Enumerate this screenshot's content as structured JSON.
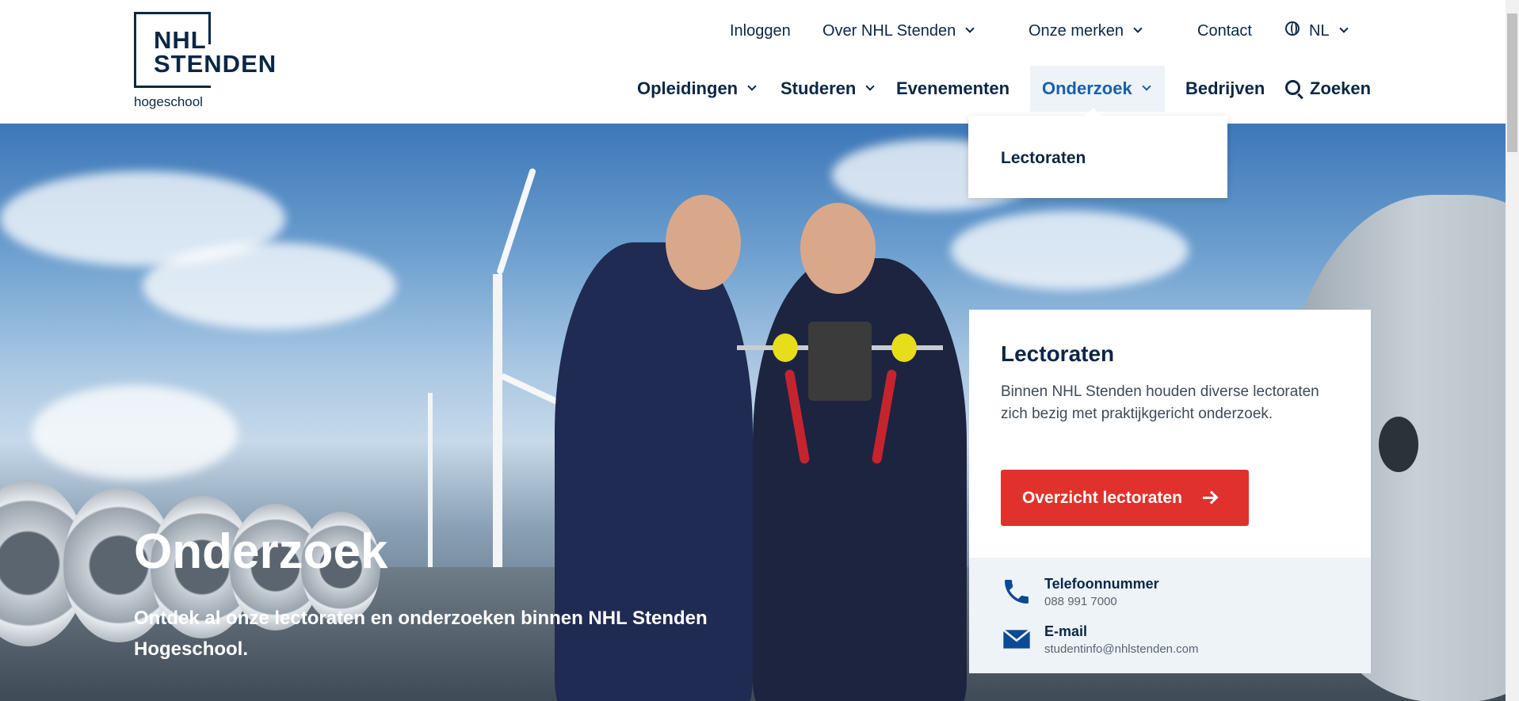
{
  "logo": {
    "line1": "NHL",
    "line2": "STENDEN",
    "sub": "hogeschool"
  },
  "topnav": {
    "login": "Inloggen",
    "about": "Over NHL Stenden",
    "brands": "Onze merken",
    "contact": "Contact",
    "language": "NL"
  },
  "mainnav": {
    "programs": "Opleidingen",
    "study": "Studeren",
    "events": "Evenementen",
    "research": "Onderzoek",
    "business": "Bedrijven",
    "search": "Zoeken"
  },
  "dropdown": {
    "item": "Lectoraten"
  },
  "hero": {
    "title": "Onderzoek",
    "subtitle": "Ontdek al onze lectoraten en onderzoeken binnen NHL Stenden Hogeschool."
  },
  "card": {
    "title": "Lectoraten",
    "text": "Binnen NHL Stenden houden diverse lectoraten zich bezig met praktijkgericht onderzoek.",
    "button": "Overzicht lectoraten",
    "phone_label": "Telefoonnummer",
    "phone_value": "088 991 7000",
    "email_label": "E-mail",
    "email_value": "studentinfo@nhlstenden.com"
  },
  "colors": {
    "brand": "#0b2745",
    "active": "#1a5fa8",
    "button": "#e0312c"
  }
}
